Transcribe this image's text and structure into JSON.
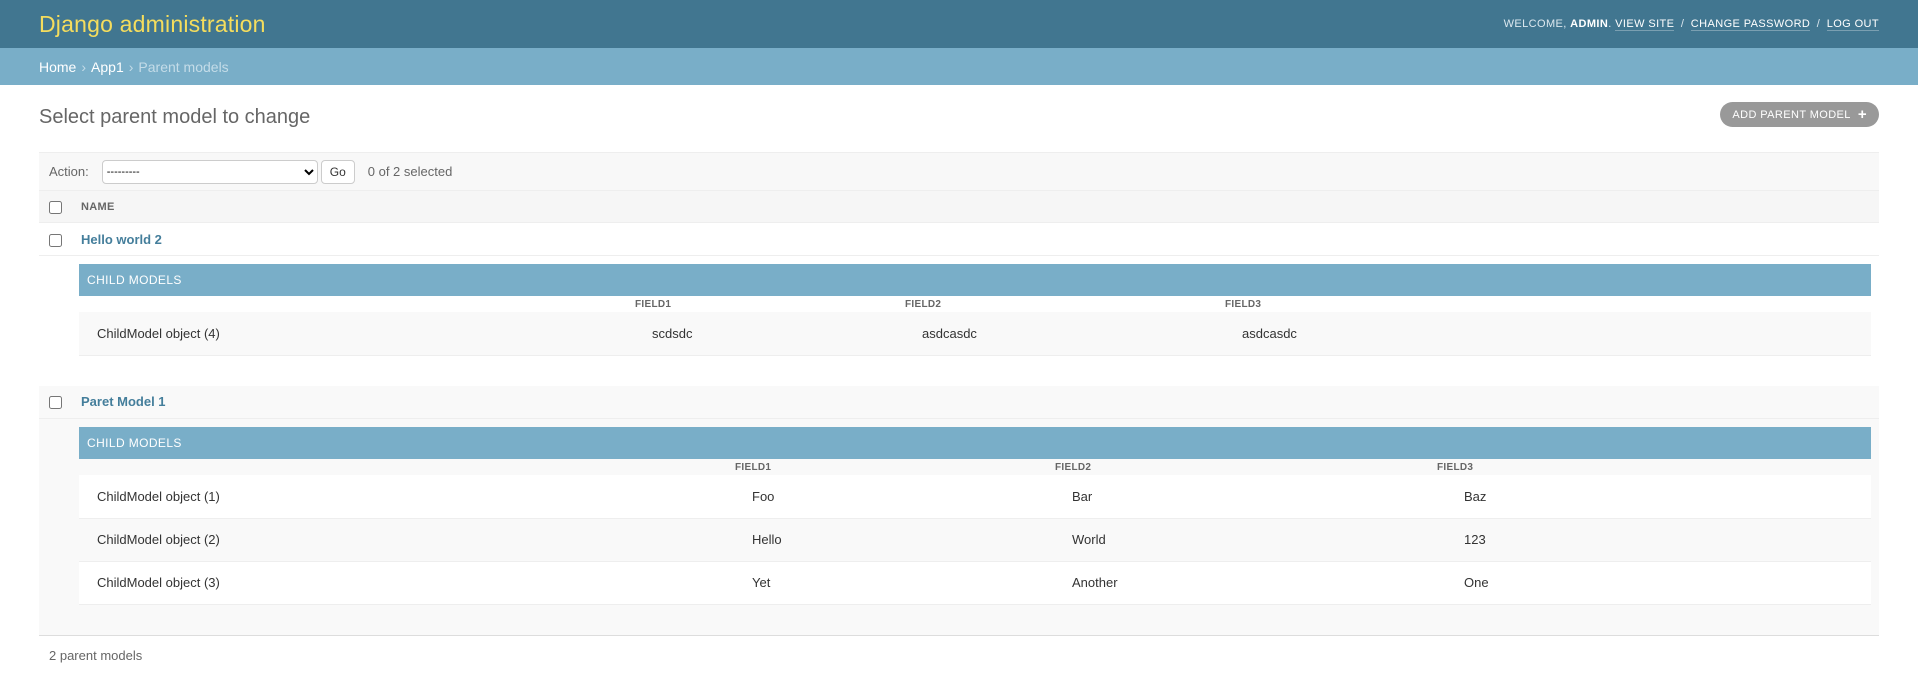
{
  "header": {
    "branding": "Django administration",
    "welcome": "Welcome,",
    "username": "admin",
    "view_site": "View site",
    "change_password": "Change password",
    "log_out": "Log out"
  },
  "breadcrumbs": {
    "home": "Home",
    "app": "App1",
    "current": "Parent models"
  },
  "page": {
    "title": "Select parent model to change",
    "add_button": "Add parent model"
  },
  "actions": {
    "label": "Action:",
    "selected_option": "---------",
    "go": "Go",
    "selection_count": "0 of 2 selected"
  },
  "table": {
    "header_name": "Name",
    "inline_caption": "Child models",
    "inline_columns": [
      "Field1",
      "Field2",
      "Field3"
    ],
    "parents": [
      {
        "name": "Hello world 2",
        "children": [
          {
            "object": "ChildModel object (4)",
            "field1": "scdsdc",
            "field2": "asdcasdc",
            "field3": "asdcasdc"
          }
        ]
      },
      {
        "name": "Paret Model 1",
        "children": [
          {
            "object": "ChildModel object (1)",
            "field1": "Foo",
            "field2": "Bar",
            "field3": "Baz"
          },
          {
            "object": "ChildModel object (2)",
            "field1": "Hello",
            "field2": "World",
            "field3": "123"
          },
          {
            "object": "ChildModel object (3)",
            "field1": "Yet",
            "field2": "Another",
            "field3": "One"
          }
        ]
      }
    ]
  },
  "paginator": "2 parent models",
  "colors": {
    "header_bg": "#417690",
    "branding": "#f5dd5d",
    "breadcrumbs_bg": "#79aec8",
    "link": "#447e9b"
  }
}
